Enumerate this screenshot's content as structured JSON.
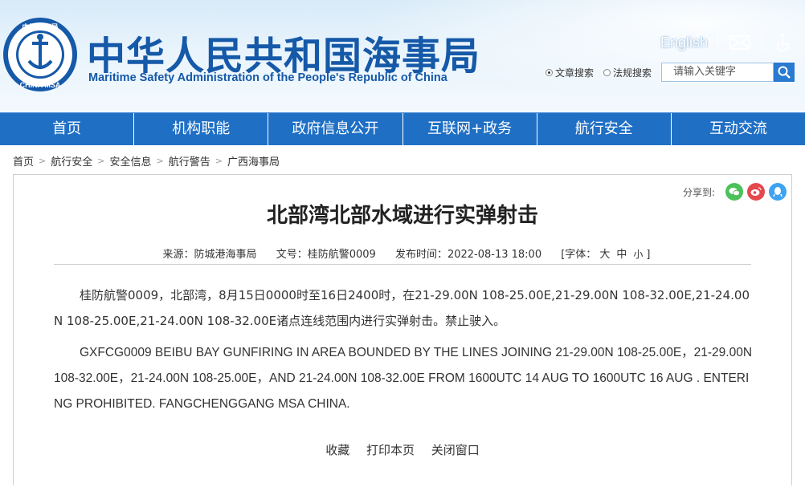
{
  "header": {
    "title_cn": "中华人民共和国海事局",
    "title_en": "Maritime Safety Administration of the People's Republic of China",
    "logo": {
      "top_text": "中国海事局",
      "bottom_text": "CHINA MSA"
    },
    "english_link": "English",
    "mail_icon": "mail-icon",
    "accessibility_icon": "accessibility-icon",
    "search": {
      "options": [
        "文章搜索",
        "法规搜索"
      ],
      "selected": "文章搜索",
      "placeholder": "请输入关键字"
    }
  },
  "nav": [
    "首页",
    "机构职能",
    "政府信息公开",
    "互联网+政务",
    "航行安全",
    "互动交流"
  ],
  "breadcrumb": [
    "首页",
    "航行安全",
    "安全信息",
    "航行警告",
    "广西海事局"
  ],
  "share": {
    "label": "分享到:",
    "icons": [
      "wechat-icon",
      "weibo-icon",
      "qq-icon"
    ]
  },
  "article": {
    "title": "北部湾北部水域进行实弹射击",
    "source": "来源：防城港海事局",
    "doc_no": "文号：桂防航警0009",
    "publish_time": "发布时间：2022-08-13 18:00",
    "font_size": {
      "open": "[字体：",
      "large": "大",
      "medium": "中",
      "small": "小",
      "close": "]"
    },
    "para_cn": "桂防航警0009，北部湾，8月15日0000时至16日2400时，在21-29.00N 108-25.00E,21-29.00N 108-32.00E,21-24.00N 108-25.00E,21-24.00N 108-32.00E诸点连线范围内进行实弹射击。禁止驶入。",
    "para_en": "GXFCG0009 BEIBU BAY GUNFIRING IN AREA BOUNDED BY THE LINES JOINING 21-29.00N 108-25.00E，21-29.00N 108-32.00E，21-24.00N 108-25.00E，AND 21-24.00N 108-32.00E      FROM 1600UTC 14 AUG TO 1600UTC 16 AUG . ENTERING PROHIBITED. FANGCHENGGANG MSA CHINA."
  },
  "actions": [
    "收藏",
    "打印本页",
    "关闭窗口"
  ],
  "colors": {
    "brand_blue": "#1559a8",
    "nav_blue": "#1f6fc5"
  }
}
